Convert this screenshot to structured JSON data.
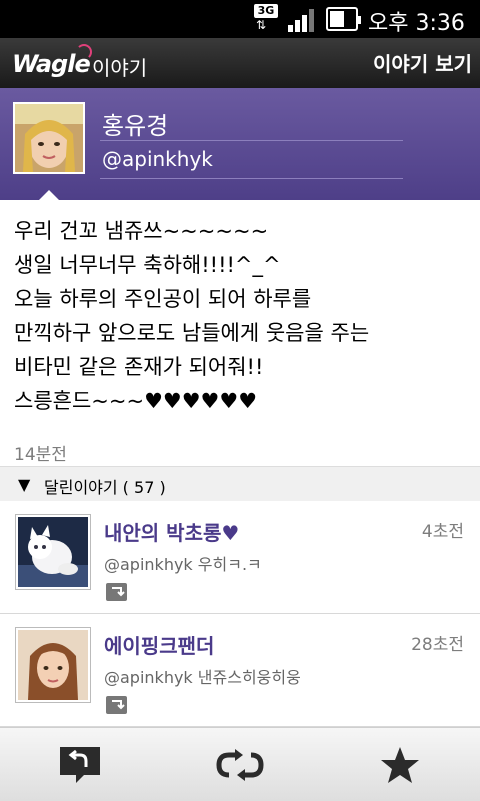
{
  "status_bar": {
    "network": "3G",
    "time": "오후 3:36"
  },
  "app_bar": {
    "logo": "Wagle",
    "logo_suffix": "이야기",
    "view_button": "이야기 보기"
  },
  "profile": {
    "name": "홍유경",
    "handle": "@apinkhyk"
  },
  "tweet": {
    "lines": [
      "우리 건꼬 냄쥬쓰~~~~~~",
      "생일 너무너무 축하해!!!!^_^",
      "오늘 하루의 주인공이 되어 하루를",
      "만끽하구 앞으로도 남들에게 웃음을 주는",
      "비타민 같은 존재가 되어줘!!",
      "스릉흔드~~~♥♥♥♥♥♥"
    ],
    "time_ago": "14분전"
  },
  "replies": {
    "header": "달린이야기 ( 57 )",
    "items": [
      {
        "name": "내안의 박초롱♥",
        "time_ago": "4초전",
        "handle": "@apinkhyk",
        "text": "우히ㅋ.ㅋ"
      },
      {
        "name": "에이핑크팬더",
        "time_ago": "28초전",
        "handle": "@apinkhyk",
        "text": "낸쥬스히웅히웅"
      }
    ]
  },
  "bottom_bar": {
    "icons": [
      "reply-icon",
      "retweet-icon",
      "star-icon"
    ]
  },
  "colors": {
    "profile_bg": "#5a4a96",
    "reply_name": "#4a3a8a",
    "appbar_bg": "#1f1f1f"
  }
}
